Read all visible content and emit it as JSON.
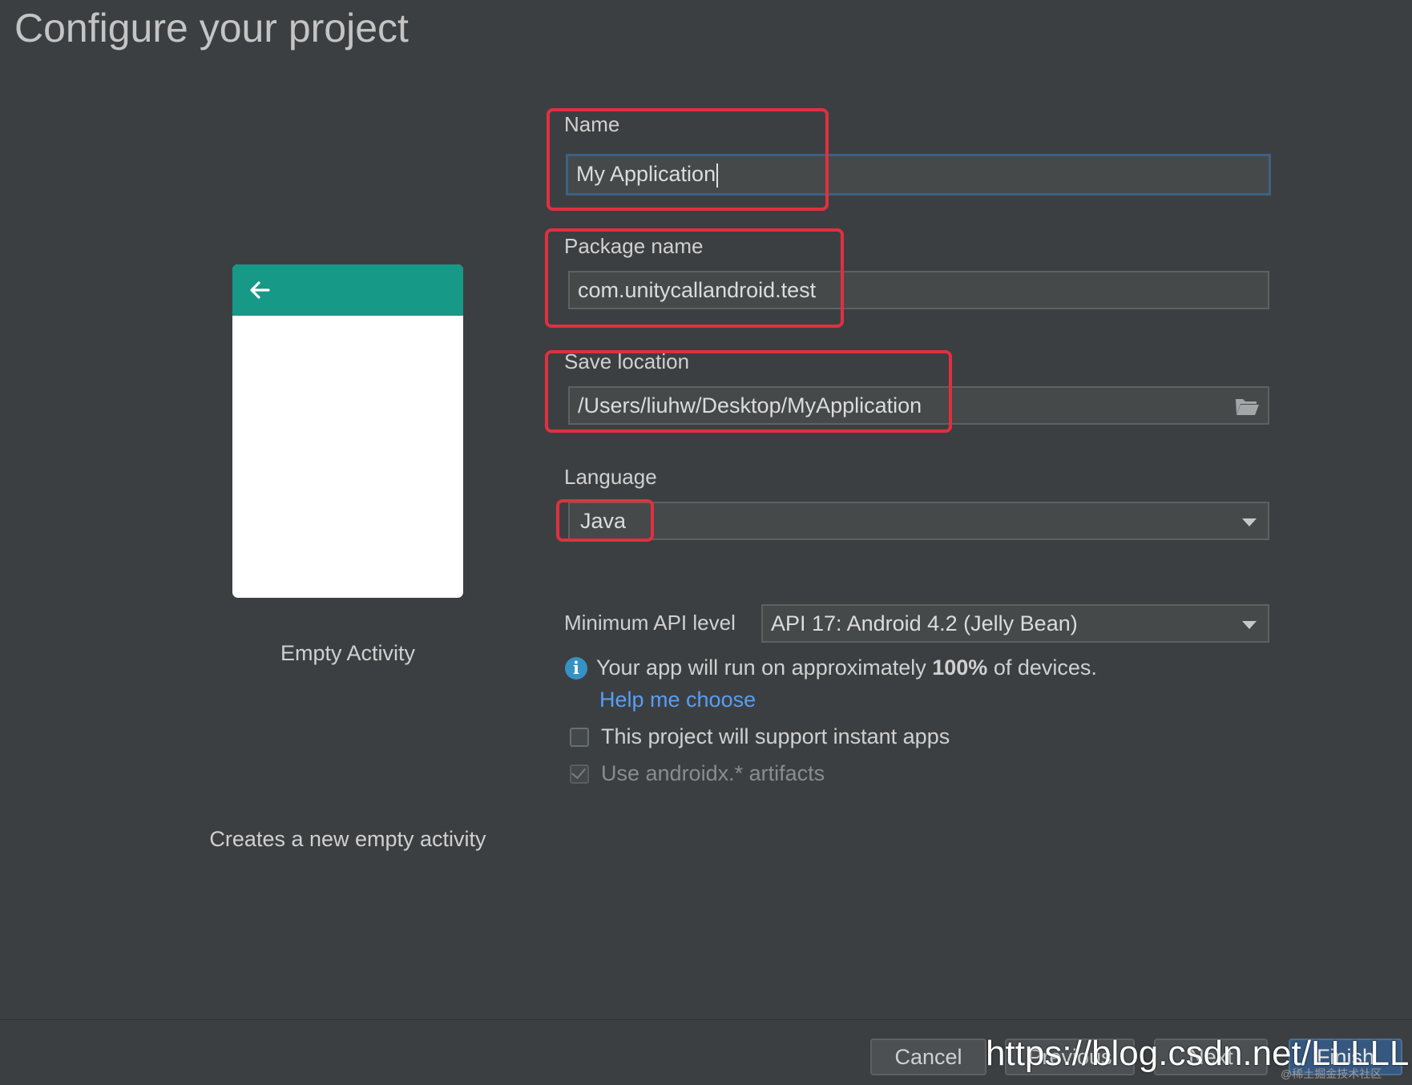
{
  "page": {
    "title": "Configure your project"
  },
  "template": {
    "name": "Empty Activity",
    "description": "Creates a new empty activity",
    "header_color": "#169987",
    "back_icon": "arrow-left-icon"
  },
  "form": {
    "name": {
      "label": "Name",
      "value": "My Application"
    },
    "package": {
      "label": "Package name",
      "value": "com.unitycallandroid.test"
    },
    "save_location": {
      "label": "Save location",
      "value": "/Users/liuhw/Desktop/MyApplication",
      "icon": "folder-icon"
    },
    "language": {
      "label": "Language",
      "value": "Java"
    },
    "min_api": {
      "label": "Minimum API level",
      "value": "API 17: Android 4.2 (Jelly Bean)"
    },
    "info": {
      "prefix": "Your app will run on approximately ",
      "percent": "100%",
      "suffix": " of devices."
    },
    "help_link": "Help me choose",
    "instant_apps": {
      "label": "This project will support instant apps",
      "checked": false
    },
    "androidx": {
      "label": "Use androidx.* artifacts",
      "checked": true,
      "disabled": true
    }
  },
  "buttons": {
    "cancel": "Cancel",
    "previous": "Previous",
    "next": "Next",
    "finish": "Finish"
  },
  "watermark": {
    "url": "https://blog.csdn.net/LLLLL",
    "small": "@稀土掘金技术社区"
  },
  "colors": {
    "background": "#3c3f41",
    "highlight": "#e0303f",
    "link": "#589df6",
    "primary_button": "#365880"
  }
}
